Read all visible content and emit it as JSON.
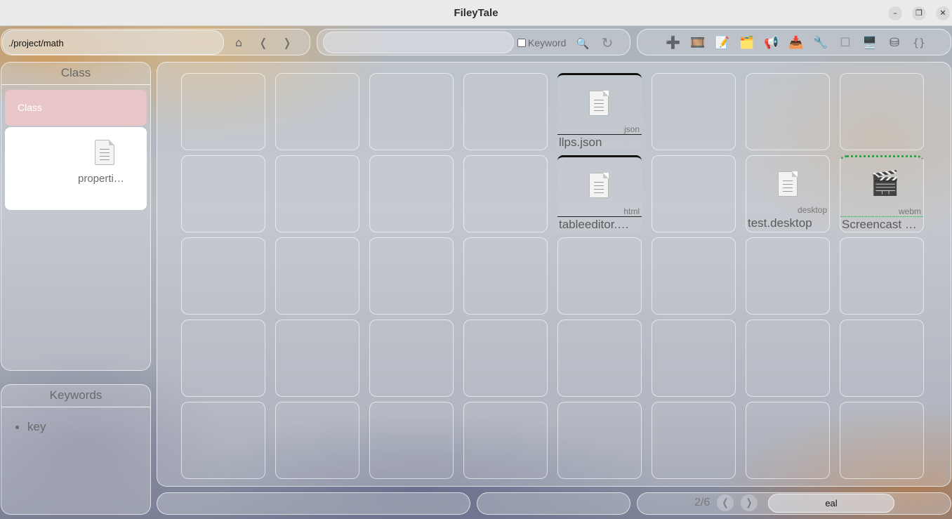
{
  "window": {
    "title": "FileyTale"
  },
  "toolbar": {
    "path_value": "./project/math",
    "home_glyph": "⌂",
    "back_glyph": "❬",
    "forward_glyph": "❭",
    "search_value": "",
    "keyword_label": "Keyword",
    "search_glyph": "🔍",
    "refresh_glyph": "↻",
    "tools": [
      {
        "icon": "plus-icon",
        "glyph": "➕"
      },
      {
        "icon": "film-icon",
        "glyph": "🎞️"
      },
      {
        "icon": "memo-icon",
        "glyph": "📝"
      },
      {
        "icon": "card-index-icon",
        "glyph": "🗂️"
      },
      {
        "icon": "megaphone-icon",
        "glyph": "📢"
      },
      {
        "icon": "inbox-icon",
        "glyph": "📥"
      },
      {
        "icon": "wrench-icon",
        "glyph": "🔧"
      },
      {
        "icon": "square-icon",
        "glyph": "☐"
      },
      {
        "icon": "desktop-icon",
        "glyph": "🖥️"
      },
      {
        "icon": "database-icon",
        "glyph": "⛁"
      },
      {
        "icon": "braces-icon",
        "glyph": "{}"
      }
    ]
  },
  "sidebar": {
    "class_title": "Class",
    "selected_class": "Class",
    "class_file": "properti…",
    "keywords_title": "Keywords",
    "keywords": [
      "key"
    ]
  },
  "files": [
    {
      "row": 0,
      "col": 4,
      "name": "llps.json",
      "ext": "json",
      "style": "boxed",
      "icon": "document-icon"
    },
    {
      "row": 1,
      "col": 4,
      "name": "tableeditor.…",
      "ext": "html",
      "style": "boxed",
      "icon": "document-icon"
    },
    {
      "row": 1,
      "col": 6,
      "name": "test.desktop",
      "ext": "desktop",
      "style": "plain",
      "icon": "document-icon"
    },
    {
      "row": 1,
      "col": 7,
      "name": "Screencast …",
      "ext": "webm",
      "style": "dotted",
      "icon": "clapper-board-icon"
    }
  ],
  "statusbar": {
    "page": "2/6",
    "prev_glyph": "❬",
    "next_glyph": "❭",
    "field_value": "eal"
  }
}
